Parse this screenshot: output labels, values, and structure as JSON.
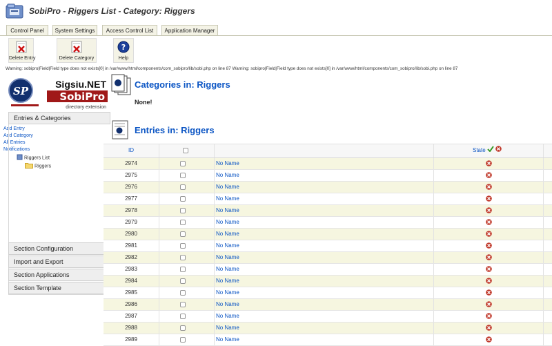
{
  "header": {
    "title": "SobiPro - Riggers List - Category: Riggers"
  },
  "tabs": [
    {
      "label": "Control Panel"
    },
    {
      "label": "System Settings"
    },
    {
      "label": "Access Control List"
    },
    {
      "label": "Application Manager"
    }
  ],
  "toolbar": {
    "delete_entry": "Delete Entry",
    "delete_category": "Delete Category",
    "help": "Help"
  },
  "warning": "Warning: sobipro|Field|Field type does not exists[0] in /var/www/html/components/com_sobipro/lib/sobi.php on line 87 Warning: sobipro|Field|Field type does not exists[0] in /var/www/html/components/com_sobipro/lib/sobi.php on line 87",
  "logo": {
    "text_top": "Sigsiu.NET",
    "text_main": "SobiPro",
    "text_sub": "directory extension",
    "badge": "SP"
  },
  "sidebar": {
    "entries_categories": "Entries & Categories",
    "links": [
      "Add Entry",
      "Add Category",
      "All Entries",
      "Notifications"
    ],
    "tree_root": "Riggers List",
    "tree_child": "Riggers",
    "sections": [
      "Section Configuration",
      "Import and Export",
      "Section Applications",
      "Section Template"
    ]
  },
  "content": {
    "categories_heading": "Categories in: Riggers",
    "categories_empty": "None!",
    "entries_heading": "Entries in: Riggers"
  },
  "table": {
    "columns": {
      "id": "ID",
      "state": "State"
    },
    "rows": [
      {
        "id": "2974",
        "name": "No Name"
      },
      {
        "id": "2975",
        "name": "No Name"
      },
      {
        "id": "2976",
        "name": "No Name"
      },
      {
        "id": "2977",
        "name": "No Name"
      },
      {
        "id": "2978",
        "name": "No Name"
      },
      {
        "id": "2979",
        "name": "No Name"
      },
      {
        "id": "2980",
        "name": "No Name"
      },
      {
        "id": "2981",
        "name": "No Name"
      },
      {
        "id": "2982",
        "name": "No Name"
      },
      {
        "id": "2983",
        "name": "No Name"
      },
      {
        "id": "2984",
        "name": "No Name"
      },
      {
        "id": "2985",
        "name": "No Name"
      },
      {
        "id": "2986",
        "name": "No Name"
      },
      {
        "id": "2987",
        "name": "No Name"
      },
      {
        "id": "2988",
        "name": "No Name"
      },
      {
        "id": "2989",
        "name": "No Name"
      }
    ]
  },
  "colors": {
    "link": "#0b55c4",
    "odd_row": "#f6f6e0",
    "unpublished": "#c0392b",
    "published": "#3a9a2a"
  }
}
